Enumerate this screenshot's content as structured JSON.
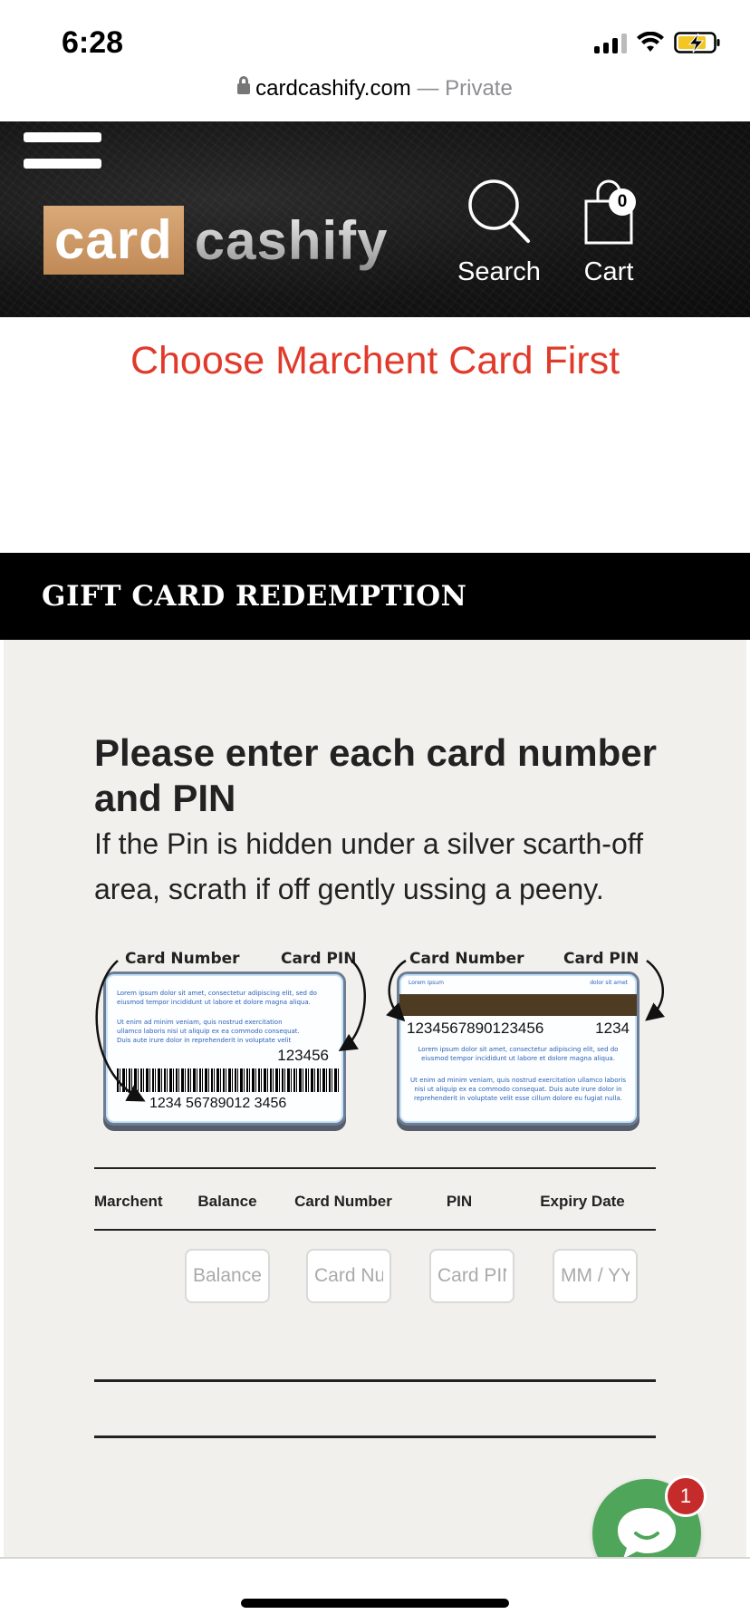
{
  "status_bar": {
    "time": "6:28",
    "url": "cardcashify.com",
    "separator": "—",
    "private_label": "Private"
  },
  "header": {
    "logo": {
      "part1": "card",
      "part2": "cashify",
      "accent_color": "#c79464"
    },
    "search_label": "Search",
    "cart_label": "Cart",
    "cart_count": "0",
    "icons": {
      "menu": "hamburger-icon",
      "search": "search-icon",
      "cart": "shopping-bag-icon"
    }
  },
  "notice": {
    "text": "Choose Marchent Card First",
    "color": "#e13a2a"
  },
  "section": {
    "title": "GIFT CARD REDEMPTION"
  },
  "instructions": {
    "title": "Please enter each card number and PIN",
    "body": "If the Pin is hidden under a silver scarth-off area, scrath if off gently ussing a peeny."
  },
  "illustration": {
    "front": {
      "label_number": "Card Number",
      "label_pin": "Card PIN",
      "pin": "123456",
      "number": "1234 56789012 3456"
    },
    "back": {
      "label_number": "Card Number",
      "label_pin": "Card PIN",
      "number": "1234567890123456",
      "pin": "1234",
      "stripe_left": "Lorem ipsum",
      "stripe_right": "dolor sit amet"
    },
    "lorem_1": "Lorem ipsum dolor sit amet, consectetur adipiscing elit, sed do eiusmod tempor incididunt ut labore et dolore magna aliqua.",
    "lorem_2": "Ut enim ad minim veniam, quis nostrud exercitation ullamco laboris nisi ut aliquip ex ea commodo consequat. Duis aute irure dolor in reprehenderit in voluptate velit esse cillum dolore eu fugiat nulla."
  },
  "table": {
    "headers": [
      "Marchent",
      "Balance",
      "Card Number",
      "PIN",
      "Expiry Date"
    ],
    "placeholders": {
      "balance": "Balance",
      "card_number": "Card Number",
      "pin": "Card PIN",
      "expiry": "MM / YY"
    }
  },
  "chat": {
    "badge_count": "1",
    "color": "#4fa55a",
    "icon": "chat-bubble-icon"
  }
}
